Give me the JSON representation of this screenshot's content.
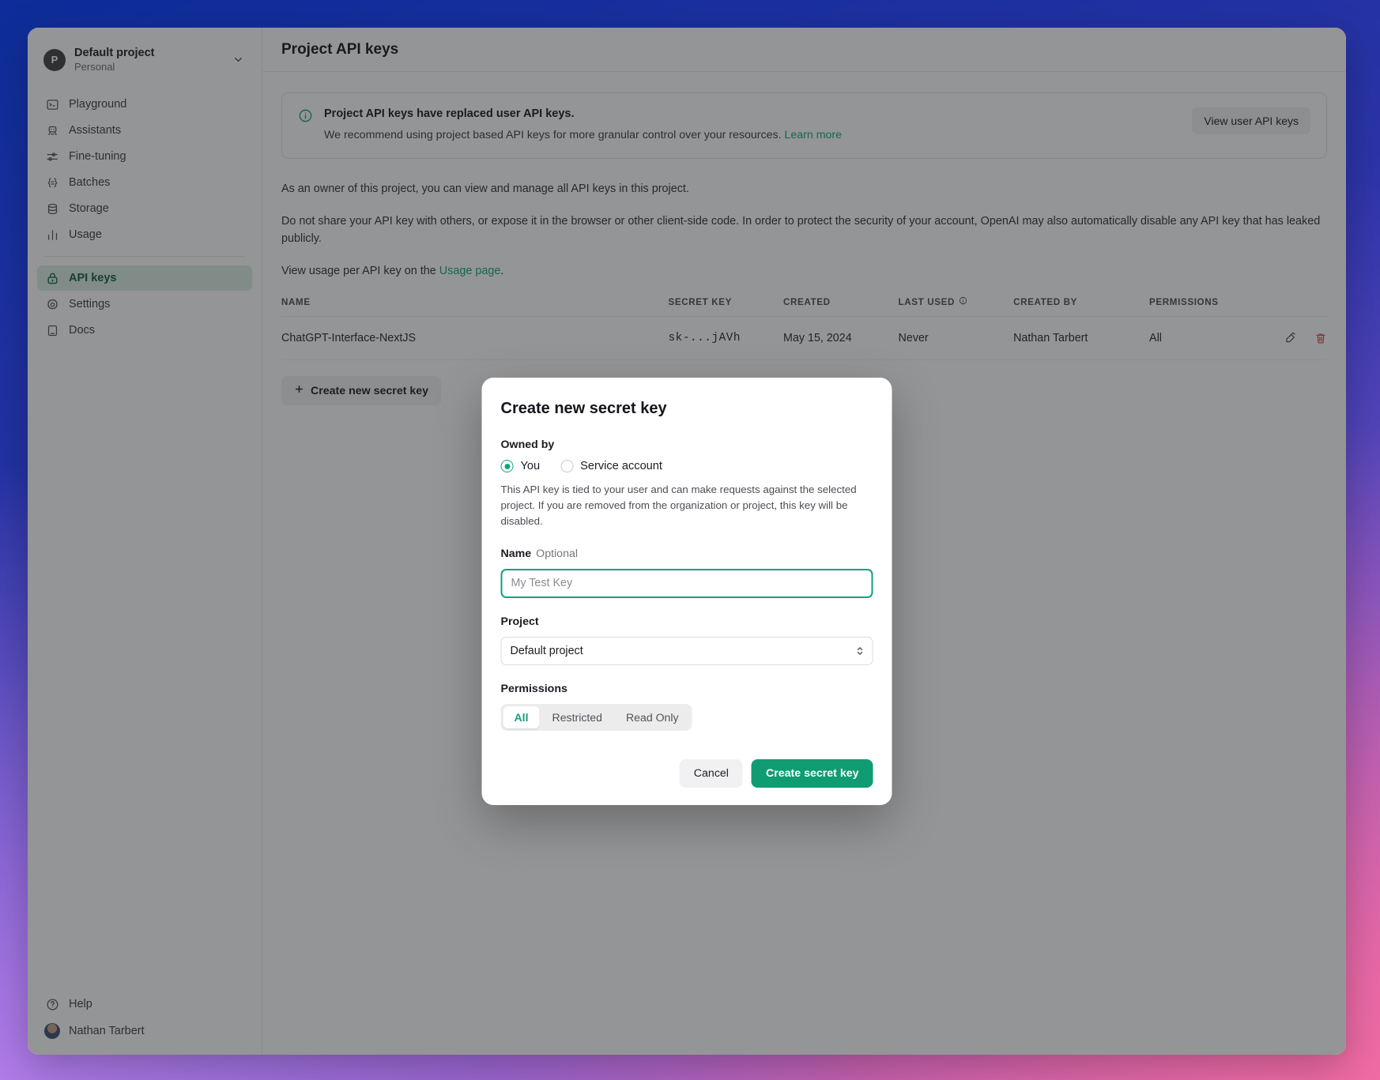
{
  "window": {
    "sidebar": {
      "project": {
        "avatar_letter": "P",
        "name": "Default project",
        "subtitle": "Personal",
        "chevron_icon": "chevron-down-icon"
      },
      "nav_primary": [
        {
          "label": "Playground",
          "icon": "playground-icon"
        },
        {
          "label": "Assistants",
          "icon": "assistants-robot-icon"
        },
        {
          "label": "Fine-tuning",
          "icon": "fine-tuning-sliders-icon"
        },
        {
          "label": "Batches",
          "icon": "batches-braces-icon"
        },
        {
          "label": "Storage",
          "icon": "storage-database-icon"
        },
        {
          "label": "Usage",
          "icon": "usage-bar-chart-icon"
        }
      ],
      "nav_secondary": [
        {
          "label": "API keys",
          "icon": "lock-icon",
          "active": true
        },
        {
          "label": "Settings",
          "icon": "gear-icon",
          "active": false
        },
        {
          "label": "Docs",
          "icon": "book-icon",
          "active": false
        }
      ],
      "bottom": [
        {
          "label": "Help",
          "icon": "help-circle-icon"
        },
        {
          "label": "Nathan Tarbert",
          "icon": "user-avatar"
        }
      ]
    },
    "header": {
      "title": "Project API keys"
    },
    "banner": {
      "icon": "info-circle-icon",
      "title": "Project API keys have replaced user API keys.",
      "description": "We recommend using project based API keys for more granular control over your resources.",
      "link_label": "Learn more",
      "action_label": "View user API keys"
    },
    "paragraphs": {
      "p1": "As an owner of this project, you can view and manage all API keys in this project.",
      "p2": "Do not share your API key with others, or expose it in the browser or other client-side code. In order to protect the security of your account, OpenAI may also automatically disable any API key that has leaked publicly.",
      "p3_prefix": "View usage per API key on the ",
      "p3_link": "Usage page",
      "p3_suffix": "."
    },
    "table": {
      "columns": [
        "NAME",
        "SECRET KEY",
        "CREATED",
        "LAST USED",
        "CREATED BY",
        "PERMISSIONS"
      ],
      "last_used_info_icon": "info-circle-small-icon",
      "rows": [
        {
          "name": "ChatGPT-Interface-NextJS",
          "secret_key": "sk-...jAVh",
          "created": "May 15, 2024",
          "last_used": "Never",
          "created_by": "Nathan Tarbert",
          "permissions": "All",
          "edit_icon": "edit-pencil-icon",
          "delete_icon": "trash-icon"
        }
      ]
    },
    "create_button": {
      "label": "Create new secret key",
      "icon": "plus-icon"
    }
  },
  "modal": {
    "title": "Create new secret key",
    "owned_by": {
      "label": "Owned by",
      "options": [
        {
          "label": "You",
          "checked": true
        },
        {
          "label": "Service account",
          "checked": false
        }
      ],
      "helper": "This API key is tied to your user and can make requests against the selected project. If you are removed from the organization or project, this key will be disabled."
    },
    "name_field": {
      "label": "Name",
      "optional": "Optional",
      "value": "",
      "placeholder": "My Test Key"
    },
    "project_field": {
      "label": "Project",
      "value": "Default project",
      "options": [
        "Default project"
      ],
      "caret_icon": "select-chevron-updown-icon"
    },
    "permissions_field": {
      "label": "Permissions",
      "options": [
        {
          "label": "All",
          "selected": true
        },
        {
          "label": "Restricted",
          "selected": false
        },
        {
          "label": "Read Only",
          "selected": false
        }
      ]
    },
    "cancel_label": "Cancel",
    "submit_label": "Create secret key"
  },
  "colors": {
    "accent_green": "#10a37f",
    "primary_button": "#109c72",
    "danger_red": "#e0393e",
    "active_nav_bg": "#dbece2",
    "active_nav_text": "#0c5f3b"
  }
}
